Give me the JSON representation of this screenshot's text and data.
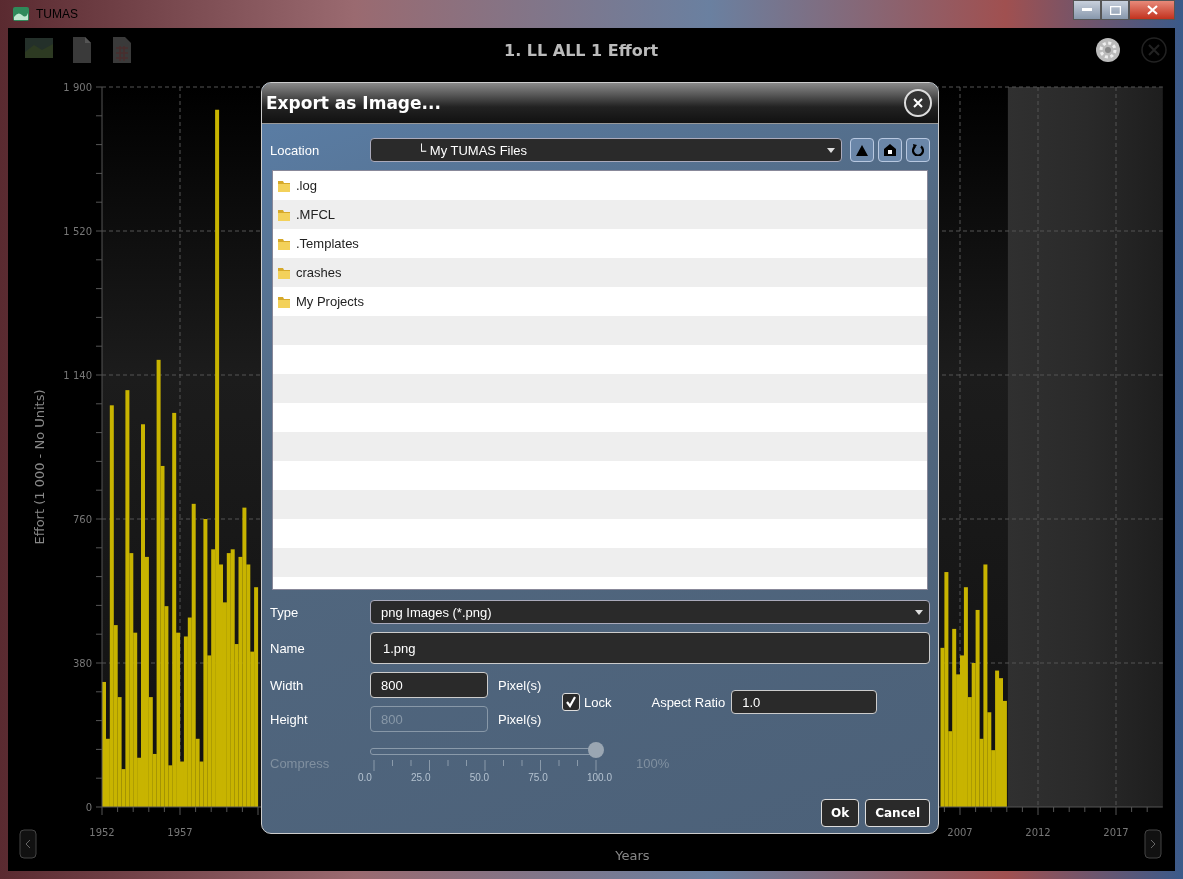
{
  "window": {
    "title": "TUMAS"
  },
  "toolbar": {
    "title": "1. LL ALL 1 Effort"
  },
  "chart": {
    "chart_data": {
      "type": "bar",
      "xlabel": "Years",
      "ylabel": "Effort (1 000 - No Units)",
      "xlim": [
        1952,
        2020
      ],
      "ylim": [
        0,
        1900
      ],
      "xticks": [
        1952,
        1957,
        2007,
        2012,
        2017
      ],
      "yticks": [
        0,
        380,
        760,
        {
          "value": 1140,
          "label": "1 140"
        },
        {
          "value": 1520,
          "label": "1 520"
        },
        {
          "value": 1900,
          "label": "1 900"
        }
      ],
      "x": [
        1952,
        1952.25,
        1952.5,
        1952.75,
        1953,
        1953.25,
        1953.5,
        1953.75,
        1954,
        1954.25,
        1954.5,
        1954.75,
        1955,
        1955.25,
        1955.5,
        1955.75,
        1956,
        1956.25,
        1956.5,
        1956.75,
        1957,
        1957.25,
        1957.5,
        1957.75,
        1958,
        1958.25,
        1958.5,
        1958.75,
        1959,
        1959.25,
        1959.5,
        1959.75,
        1960,
        1960.25,
        1960.5,
        1960.75,
        1961,
        1961.25,
        1961.5,
        1961.75,
        2005.75,
        2006,
        2006.25,
        2006.5,
        2006.75,
        2007,
        2007.25,
        2007.5,
        2007.75,
        2008,
        2008.25,
        2008.5,
        2008.75,
        2009,
        2009.25,
        2009.5,
        2009.75
      ],
      "grid": true,
      "series": [
        {
          "color": "#c8b400",
          "values": [
            330,
            180,
            1060,
            480,
            290,
            100,
            1100,
            670,
            460,
            130,
            1010,
            660,
            290,
            140,
            1180,
            900,
            530,
            110,
            1040,
            460,
            120,
            450,
            500,
            800,
            180,
            120,
            760,
            400,
            680,
            1840,
            640,
            540,
            670,
            680,
            430,
            660,
            790,
            640,
            410,
            580,
            420,
            620,
            200,
            470,
            350,
            400,
            580,
            290,
            380,
            520,
            180,
            640,
            250,
            150,
            360,
            340,
            280
          ]
        }
      ]
    }
  },
  "dialog": {
    "title": "Export as Image...",
    "location": {
      "label": "Location",
      "value": "└ My TUMAS Files"
    },
    "files": [
      {
        "name": ".log"
      },
      {
        "name": ".MFCL"
      },
      {
        "name": ".Templates"
      },
      {
        "name": "crashes"
      },
      {
        "name": "My Projects"
      }
    ],
    "type": {
      "label": "Type",
      "value": "png Images (*.png)"
    },
    "name": {
      "label": "Name",
      "value": "1.png"
    },
    "size_fields": [
      {
        "label": "Width",
        "value": "800",
        "unit": "Pixel(s)",
        "disabled": false
      },
      {
        "label": "Height",
        "value": "800",
        "unit": "Pixel(s)",
        "disabled": true
      }
    ],
    "lock": {
      "label": "Lock",
      "checked": true
    },
    "aspect_ratio": {
      "label": "Aspect Ratio",
      "value": "1.0"
    },
    "compress": {
      "label": "Compress",
      "disabled": true,
      "level": 1,
      "tick_labels": [
        "0.0",
        "25.0",
        "50.0",
        "75.0",
        "100.0"
      ],
      "reading": "100%"
    },
    "buttons": [
      {
        "label": "Ok"
      },
      {
        "label": "Cancel"
      }
    ]
  }
}
